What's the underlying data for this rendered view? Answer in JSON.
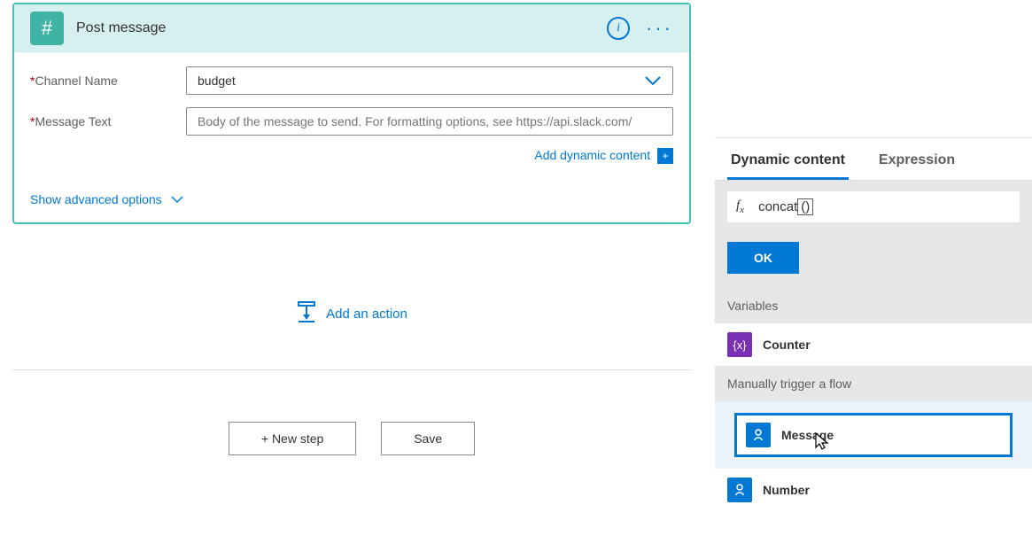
{
  "card": {
    "title": "Post message",
    "fields": {
      "channel": {
        "label": "Channel Name",
        "value": "budget"
      },
      "message": {
        "label": "Message Text",
        "placeholder": "Body of the message to send. For formatting options, see https://api.slack.com/"
      }
    },
    "add_dynamic": "Add dynamic content",
    "advanced": "Show advanced options"
  },
  "actions": {
    "add_action": "Add an action",
    "new_step": "+ New step",
    "save": "Save"
  },
  "panel": {
    "tabs": {
      "dynamic": "Dynamic content",
      "expression": "Expression"
    },
    "expr_prefix": "concat",
    "ok": "OK",
    "cat_variables": "Variables",
    "item_counter": "Counter",
    "cat_trigger": "Manually trigger a flow",
    "item_message": "Message",
    "item_number": "Number"
  }
}
